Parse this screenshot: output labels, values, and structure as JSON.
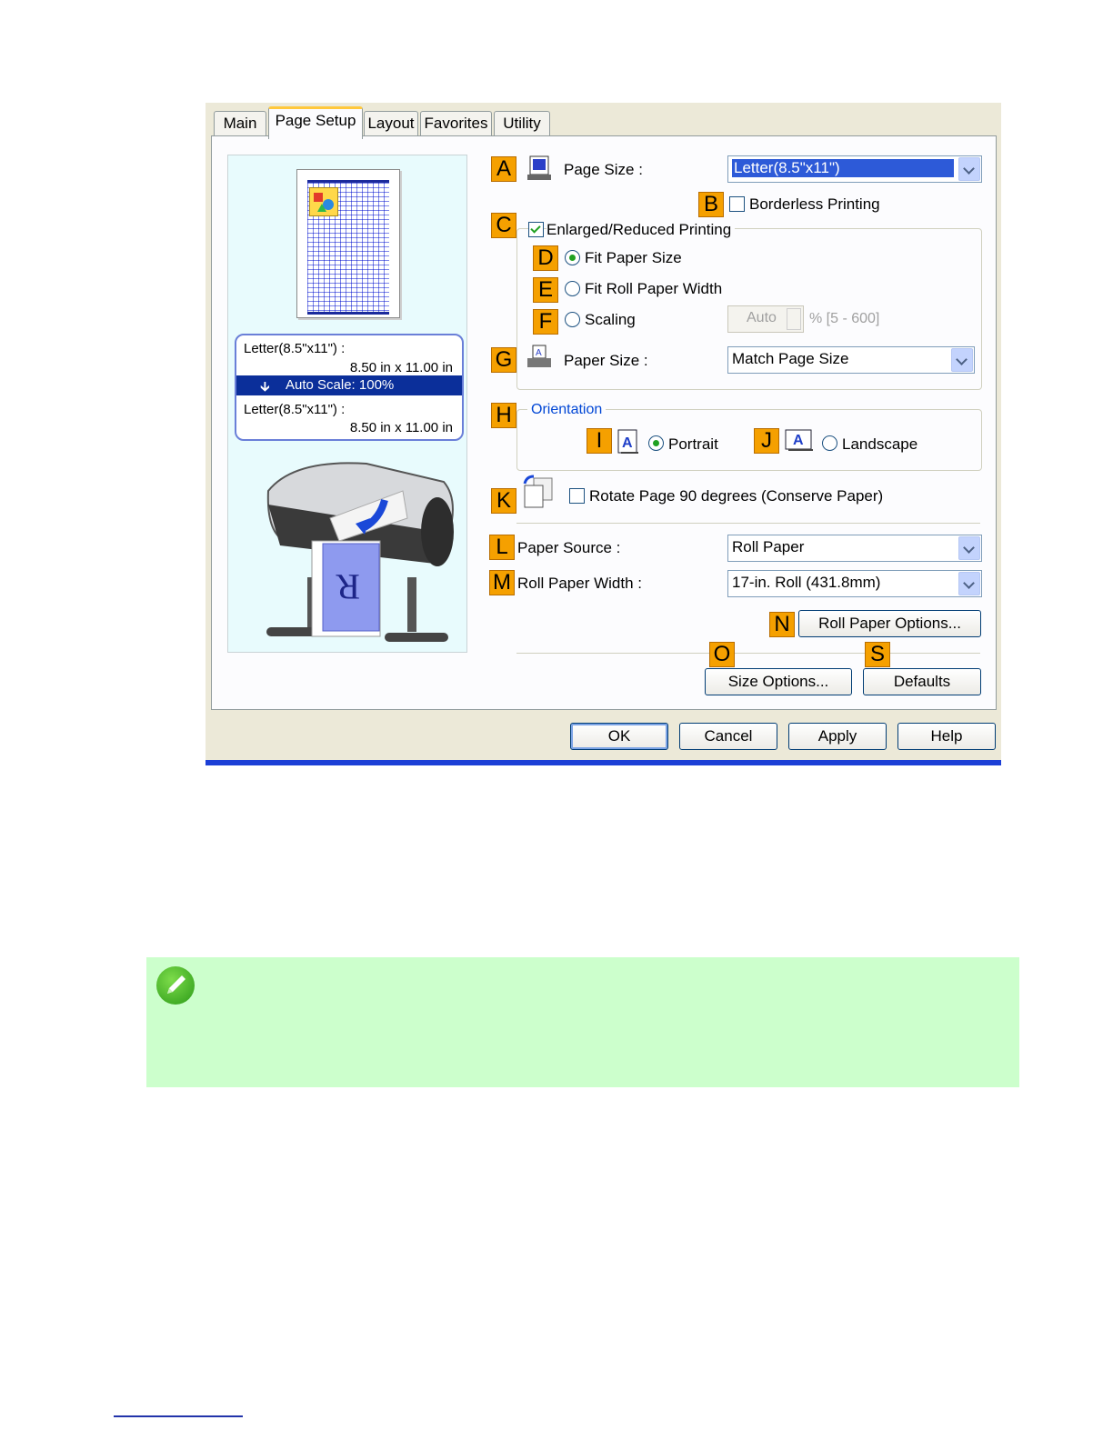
{
  "tabs": [
    "Main",
    "Page Setup",
    "Layout",
    "Favorites",
    "Utility"
  ],
  "active_tab": "Page Setup",
  "preview": {
    "line1": "Letter(8.5\"x11\") :",
    "line2": "8.50 in x 11.00 in",
    "auto_scale": "Auto Scale: 100%",
    "line3": "Letter(8.5\"x11\") :",
    "line4": "8.50 in x 11.00 in"
  },
  "labels": {
    "A": "A",
    "B": "B",
    "C": "C",
    "D": "D",
    "E": "E",
    "F": "F",
    "G": "G",
    "H": "H",
    "I": "I",
    "J": "J",
    "K": "K",
    "L": "L",
    "M": "M",
    "N": "N",
    "O": "O",
    "S": "S"
  },
  "page_size": {
    "label": "Page Size :",
    "value": "Letter(8.5\"x11\")"
  },
  "borderless": {
    "label": "Borderless Printing",
    "checked": false
  },
  "enlarged": {
    "label": "Enlarged/Reduced Printing",
    "checked": true
  },
  "fit_paper_size": {
    "label": "Fit Paper Size",
    "selected": true
  },
  "fit_roll_width": {
    "label": "Fit Roll Paper Width",
    "selected": false
  },
  "scaling": {
    "label": "Scaling",
    "value": "Auto",
    "range": "% [5 - 600]"
  },
  "paper_size": {
    "label": "Paper Size :",
    "value": "Match Page Size"
  },
  "orientation": {
    "label": "Orientation",
    "portrait": "Portrait",
    "landscape": "Landscape",
    "selected": "Portrait"
  },
  "rotate": {
    "label": "Rotate Page 90 degrees (Conserve Paper)",
    "checked": false
  },
  "paper_source": {
    "label": "Paper Source :",
    "value": "Roll Paper"
  },
  "roll_width": {
    "label": "Roll Paper Width :",
    "value": "17-in. Roll (431.8mm)"
  },
  "buttons": {
    "roll_options": "Roll Paper Options...",
    "size_options": "Size Options...",
    "defaults": "Defaults",
    "ok": "OK",
    "cancel": "Cancel",
    "apply": "Apply",
    "help": "Help"
  },
  "colors": {
    "label_orange": "#f5a000",
    "note_bg": "#ccffcc",
    "selection_blue": "#0b2f9a"
  }
}
